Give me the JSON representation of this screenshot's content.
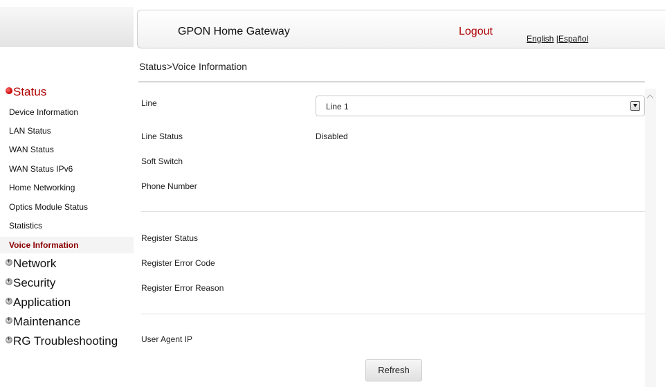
{
  "header": {
    "title": "GPON Home Gateway",
    "logout_label": "Logout",
    "lang_english": "English",
    "lang_separator": "|",
    "lang_espanol": "Español"
  },
  "breadcrumb": "Status>Voice Information",
  "sidebar": {
    "sections": [
      {
        "label": "Status",
        "expanded": true
      },
      {
        "label": "Network",
        "expanded": false
      },
      {
        "label": "Security",
        "expanded": false
      },
      {
        "label": "Application",
        "expanded": false
      },
      {
        "label": "Maintenance",
        "expanded": false
      },
      {
        "label": "RG Troubleshooting",
        "expanded": false
      }
    ],
    "status_items": [
      "Device Information",
      "LAN Status",
      "WAN Status",
      "WAN Status IPv6",
      "Home Networking",
      "Optics Module Status",
      "Statistics",
      "Voice Information"
    ],
    "selected_item": "Voice Information"
  },
  "form": {
    "line_label": "Line",
    "line_value": "Line 1",
    "line_status_label": "Line Status",
    "line_status_value": "Disabled",
    "soft_switch_label": "Soft Switch",
    "soft_switch_value": "",
    "phone_number_label": "Phone Number",
    "phone_number_value": "",
    "register_status_label": "Register Status",
    "register_error_code_label": "Register Error Code",
    "register_error_reason_label": "Register Error Reason",
    "user_agent_ip_label": "User Agent IP",
    "refresh_label": "Refresh"
  },
  "colors": {
    "accent_red": "#b00000",
    "selected_item": "#8b0000"
  }
}
